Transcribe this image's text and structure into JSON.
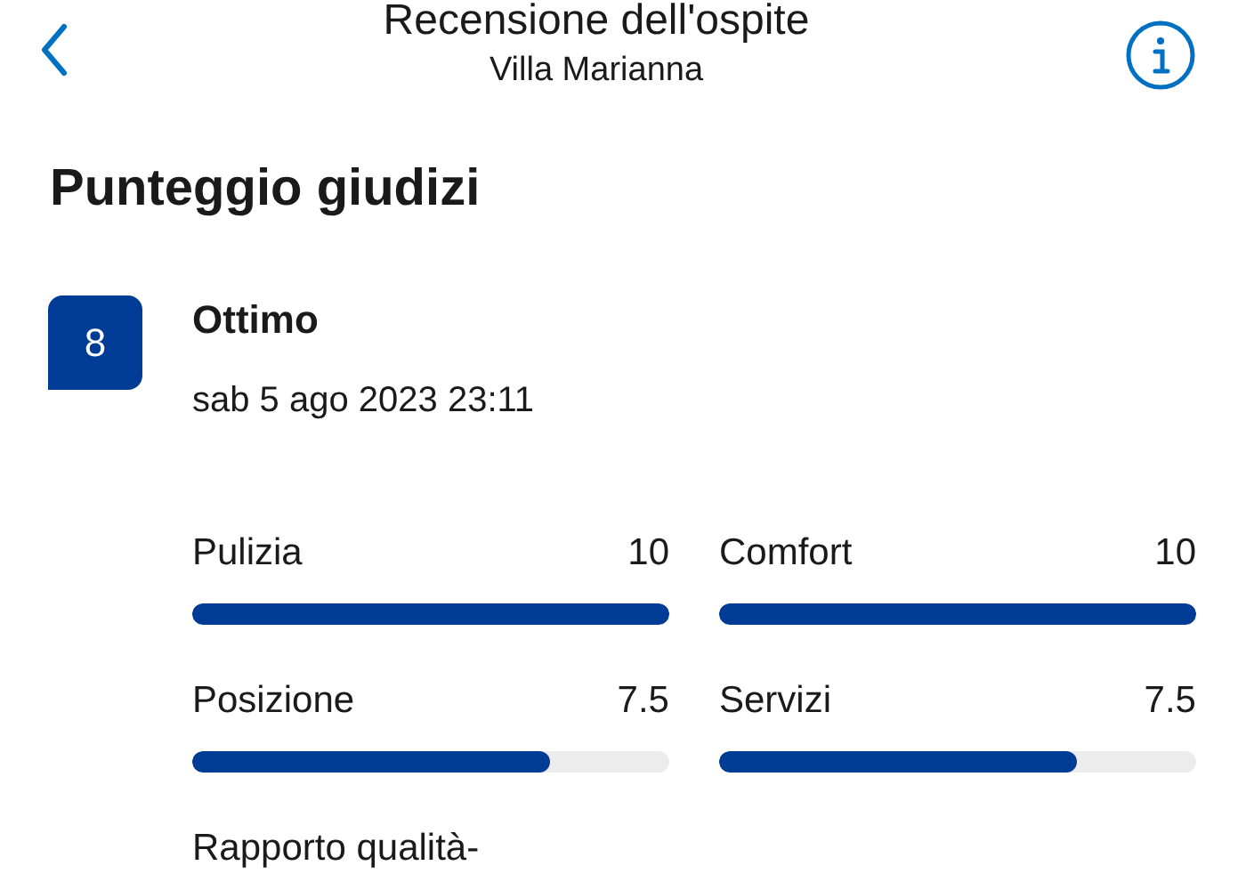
{
  "header": {
    "title": "Recensione dell'ospite",
    "subtitle": "Villa Marianna"
  },
  "heading": "Punteggio giudizi",
  "review": {
    "score": "8",
    "verdict": "Ottimo",
    "date": "sab 5 ago 2023 23:11"
  },
  "scores": [
    {
      "label": "Pulizia",
      "value": "10",
      "level": 1
    },
    {
      "label": "Comfort",
      "value": "10",
      "level": 1
    },
    {
      "label": "Posizione",
      "value": "7.5",
      "level": 0.75
    },
    {
      "label": "Servizi",
      "value": "7.5",
      "level": 0.75
    },
    {
      "label": "Rapporto qualità-"
    }
  ]
}
